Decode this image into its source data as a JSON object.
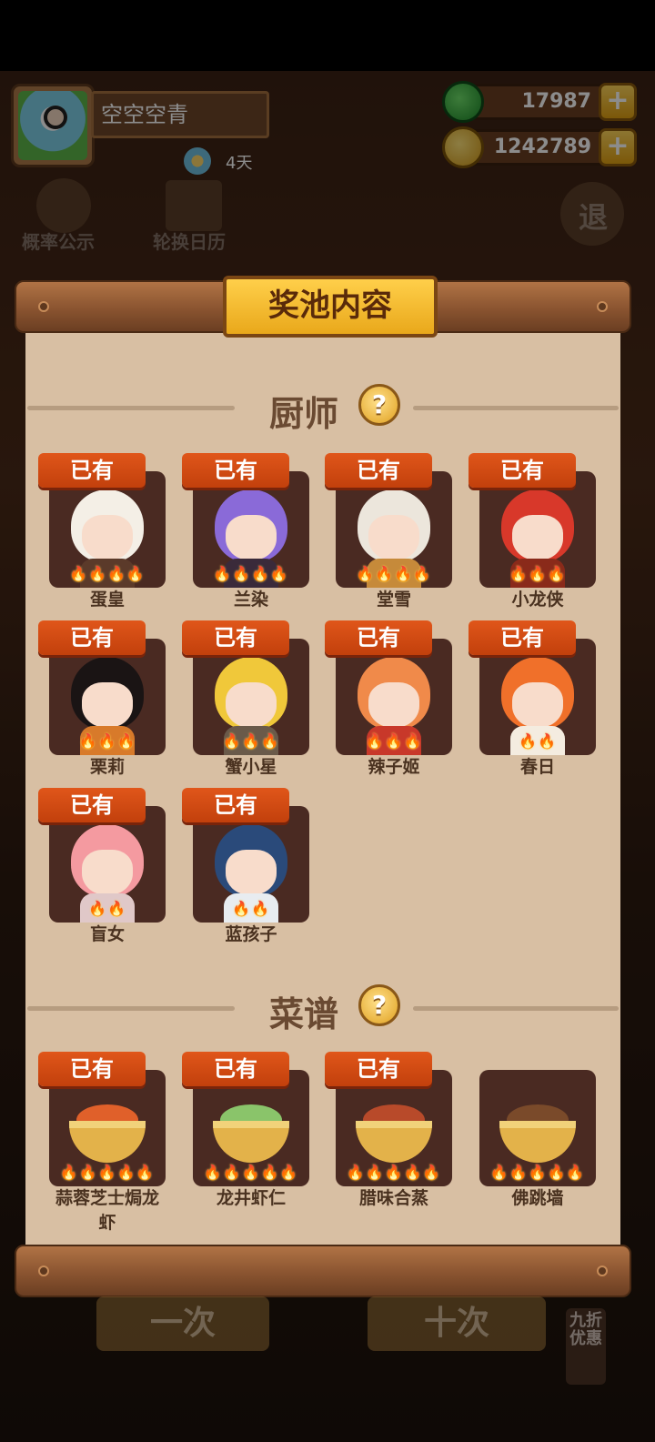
{
  "player": {
    "name": "空空空青",
    "days": "4天"
  },
  "resources": {
    "jade": "17987",
    "coins": "1242789"
  },
  "background": {
    "probability_label": "概率公示",
    "calendar_label": "轮换日历",
    "exit_label": "退",
    "single_draw": "一次",
    "ten_draw": "十次",
    "discount": "九折优惠"
  },
  "panel": {
    "title": "奖池内容",
    "owned_label": "已有",
    "chefs_section": "厨师",
    "recipes_section": "菜谱",
    "help_symbol": "?"
  },
  "chefs": [
    {
      "name": "蛋皇",
      "owned": true,
      "stars": 4,
      "hair": "#f4efe6",
      "outfit": "#5b3a2a"
    },
    {
      "name": "兰染",
      "owned": true,
      "stars": 4,
      "hair": "#8a6ad8",
      "outfit": "#3a2a3a"
    },
    {
      "name": "堂雪",
      "owned": true,
      "stars": 4,
      "hair": "#ece6dc",
      "outfit": "#c68a3a"
    },
    {
      "name": "小龙侠",
      "owned": true,
      "stars": 3,
      "hair": "#d8382a",
      "outfit": "#8a2a1a"
    },
    {
      "name": "栗莉",
      "owned": true,
      "stars": 3,
      "hair": "#1a1414",
      "outfit": "#d87a2a"
    },
    {
      "name": "蟹小星",
      "owned": true,
      "stars": 3,
      "hair": "#f0c83a",
      "outfit": "#6a5a4a"
    },
    {
      "name": "辣子姬",
      "owned": true,
      "stars": 3,
      "hair": "#f08a4a",
      "outfit": "#c8382a"
    },
    {
      "name": "春日",
      "owned": true,
      "stars": 2,
      "hair": "#f0702a",
      "outfit": "#f4ece0"
    },
    {
      "name": "盲女",
      "owned": true,
      "stars": 2,
      "hair": "#f49aa0",
      "outfit": "#e0c8c8"
    },
    {
      "name": "蓝孩子",
      "owned": true,
      "stars": 2,
      "hair": "#2a4a7a",
      "outfit": "#e8ecf0"
    }
  ],
  "recipes": [
    {
      "name": "蒜蓉芝士焗龙虾",
      "owned": true,
      "stars": 5,
      "food": "#e0602a"
    },
    {
      "name": "龙井虾仁",
      "owned": true,
      "stars": 5,
      "food": "#8ac46a"
    },
    {
      "name": "腊味合蒸",
      "owned": true,
      "stars": 5,
      "food": "#b84a2a"
    },
    {
      "name": "佛跳墙",
      "owned": false,
      "stars": 5,
      "food": "#7a4a2a"
    }
  ]
}
